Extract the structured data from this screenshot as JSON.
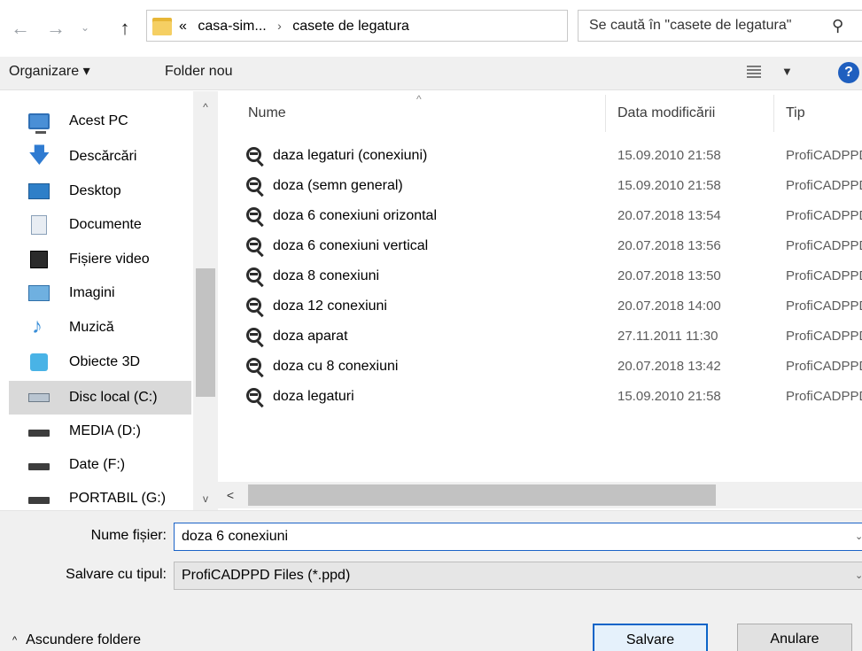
{
  "address_bar": {
    "back_glyph": "←",
    "forward_glyph": "→",
    "recent_glyph": "⌄",
    "up_glyph": "↑",
    "breadcrumb_overflow": "«",
    "breadcrumbs": [
      "casa-sim...",
      "casete de legatura"
    ],
    "breadcrumb_separator": "›",
    "dropdown_glyph": "⌄",
    "refresh_glyph": "↻"
  },
  "search": {
    "placeholder": "Se caută în \"casete de legatura\"",
    "icon": "search-icon"
  },
  "toolbar": {
    "organize_label": "Organizare ▾",
    "new_folder_label": "Folder nou",
    "view_dropdown_glyph": "▼",
    "help_label": "?"
  },
  "nav_pane": {
    "items": [
      {
        "label": "Acest PC",
        "icon": "this-pc-icon"
      },
      {
        "label": "Descărcări",
        "icon": "downloads-icon"
      },
      {
        "label": "Desktop",
        "icon": "desktop-icon"
      },
      {
        "label": "Documente",
        "icon": "documents-icon"
      },
      {
        "label": "Fișiere video",
        "icon": "videos-icon"
      },
      {
        "label": "Imagini",
        "icon": "pictures-icon"
      },
      {
        "label": "Muzică",
        "icon": "music-icon"
      },
      {
        "label": "Obiecte 3D",
        "icon": "3d-objects-icon"
      },
      {
        "label": "Disc local (C:)",
        "icon": "local-disk-icon",
        "selected": true
      },
      {
        "label": "MEDIA (D:)",
        "icon": "drive-icon"
      },
      {
        "label": "Date (F:)",
        "icon": "drive-icon"
      },
      {
        "label": "PORTABIL (G:)",
        "icon": "drive-icon"
      }
    ],
    "scroll_up_glyph": "^",
    "scroll_down_glyph": "v"
  },
  "file_list": {
    "columns": {
      "name": "Nume",
      "date": "Data modificării",
      "type": "Tip"
    },
    "sort_arrow": "^",
    "rows": [
      {
        "name": "daza legaturi (conexiuni)",
        "date": "15.09.2010 21:58",
        "type": "ProfiCADPPD"
      },
      {
        "name": "doza (semn general)",
        "date": "15.09.2010 21:58",
        "type": "ProfiCADPPD"
      },
      {
        "name": "doza 6 conexiuni orizontal",
        "date": "20.07.2018 13:54",
        "type": "ProfiCADPPD"
      },
      {
        "name": "doza 6 conexiuni vertical",
        "date": "20.07.2018 13:56",
        "type": "ProfiCADPPD"
      },
      {
        "name": "doza 8 conexiuni",
        "date": "20.07.2018 13:50",
        "type": "ProfiCADPPD"
      },
      {
        "name": "doza 12 conexiuni",
        "date": "20.07.2018 14:00",
        "type": "ProfiCADPPD"
      },
      {
        "name": "doza aparat",
        "date": "27.11.2011 11:30",
        "type": "ProfiCADPPD"
      },
      {
        "name": "doza cu 8 conexiuni",
        "date": "20.07.2018 13:42",
        "type": "ProfiCADPPD"
      },
      {
        "name": "doza legaturi",
        "date": "15.09.2010 21:58",
        "type": "ProfiCADPPD"
      }
    ],
    "hscroll_left_glyph": "<"
  },
  "form": {
    "file_name_label": "Nume fișier:",
    "file_name_value": "doza 6 conexiuni",
    "save_type_label": "Salvare cu tipul:",
    "save_type_value": "ProfiCADPPD Files (*.ppd)",
    "dropdown_glyph": "⌄"
  },
  "footer": {
    "hide_folders_chevron": "^",
    "hide_folders_label": "Ascundere foldere",
    "save_label": "Salvare",
    "cancel_label": "Anulare"
  }
}
